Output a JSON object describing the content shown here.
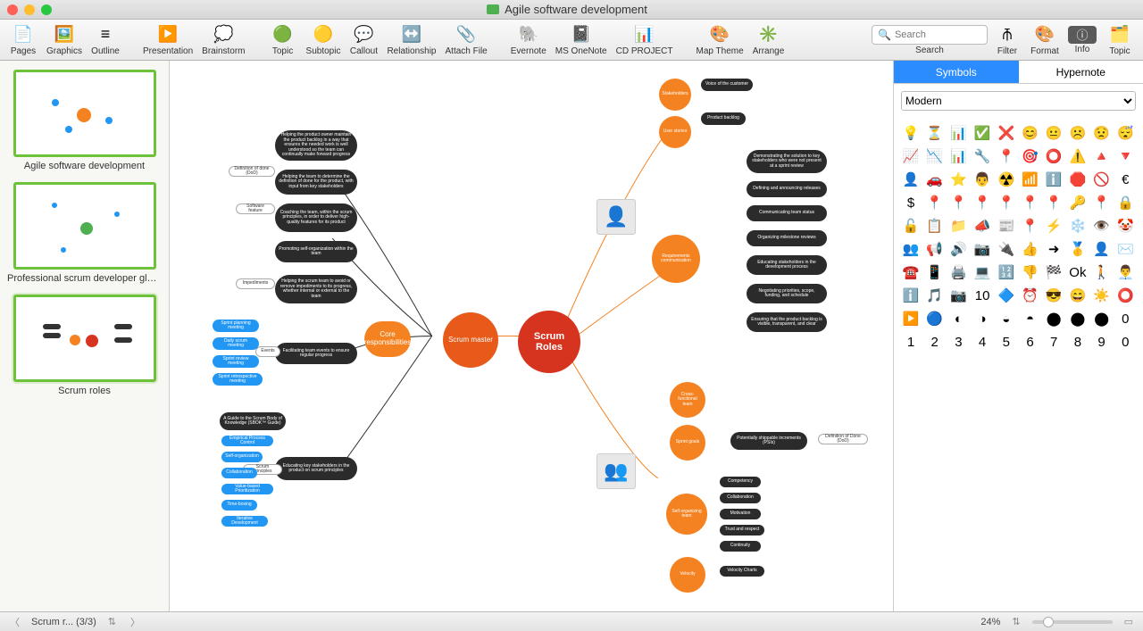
{
  "window": {
    "title": "Agile software development"
  },
  "toolbar": {
    "items": [
      {
        "label": "Pages",
        "icon": "📄"
      },
      {
        "label": "Graphics",
        "icon": "🖼️"
      },
      {
        "label": "Outline",
        "icon": "≡"
      },
      {
        "label": "Presentation",
        "icon": "▶️"
      },
      {
        "label": "Brainstorm",
        "icon": "💭"
      },
      {
        "label": "Topic",
        "icon": "🟢"
      },
      {
        "label": "Subtopic",
        "icon": "🟡"
      },
      {
        "label": "Callout",
        "icon": "💬"
      },
      {
        "label": "Relationship",
        "icon": "↔️"
      },
      {
        "label": "Attach File",
        "icon": "📎"
      },
      {
        "label": "Evernote",
        "icon": "🐘"
      },
      {
        "label": "MS OneNote",
        "icon": "📓"
      },
      {
        "label": "CD PROJECT",
        "icon": "📊"
      },
      {
        "label": "Map Theme",
        "icon": "🎨"
      },
      {
        "label": "Arrange",
        "icon": "✳️"
      }
    ],
    "search_placeholder": "Search",
    "search_label": "Search",
    "filter": "Filter",
    "format": "Format",
    "info": "Info",
    "topic": "Topic"
  },
  "thumbs": [
    {
      "caption": "Agile software development"
    },
    {
      "caption": "Professional scrum developer glos..."
    },
    {
      "caption": "Scrum roles"
    }
  ],
  "map": {
    "center": "Scrum Roles",
    "scrum_master": "Scrum master",
    "core_resp": "Core responsibilities",
    "prod_owner": {
      "stakeholders": "Stakeholders",
      "user_stories": "User stories",
      "voice": "Voice of the customer",
      "backlog": "Product backlog",
      "req_comm": "Requirements communication",
      "comm_items": [
        "Demonstrating the solution to key stakeholders who were not present at a sprint review",
        "Defining and announcing releases",
        "Communicating team status",
        "Organizing milestone reviews",
        "Educating stakeholders in the development process",
        "Negotiating priorities, scope, funding, and schedule",
        "Ensuring that the product backlog is visible, transparent, and clear"
      ]
    },
    "dev_team": {
      "cross": "Cross-functional team",
      "sprint_goals": "Sprint goals",
      "psi": "Potentially shippable increments (PSIs)",
      "dod": "Definition of Done (DoD)",
      "self_org": "Self-organizing team",
      "self_items": [
        "Competency",
        "Collaboration",
        "Motivation",
        "Trust and respect",
        "Continuity"
      ],
      "velocity": "Velocity",
      "velocity_charts": "Velocity Charts"
    },
    "sm_core": {
      "dark_items": [
        "Helping the product owner maintain the product backlog in a way that ensures the needed work is well understood so the team can continually make forward progress",
        "Helping the team to determine the definition of done for the product, with input from key stakeholders",
        "Coaching the team, within the scrum principles, in order to deliver high-quality features for its product",
        "Promoting self-organization within the team",
        "Helping the scrum team to avoid or remove impediments to its progress, whether internal or external to the team",
        "Facilitating team events to ensure regular progress",
        "Educating key stakeholders in the product on scrum principles"
      ],
      "left_tags": [
        "Definition of done (DoD)",
        "Software feature",
        "Impediments",
        "Events",
        "Scrum principles"
      ],
      "blue_items": [
        "Sprint planning meeting",
        "Daily scrum meeting",
        "Sprint review meeting",
        "Sprint retrospective meeting"
      ],
      "guide": "A Guide to the Scrum Body of Knowledge (SBOK™ Guide)",
      "edu_blue": [
        "Empirical Process Control",
        "Self-organization",
        "Collaboration",
        "Value-based Prioritization",
        "Time-boxing",
        "Iterative Development"
      ]
    }
  },
  "rpanel": {
    "tab_symbols": "Symbols",
    "tab_hypernote": "Hypernote",
    "dropdown": "Modern",
    "symbols": [
      "💡",
      "⏳",
      "📊",
      "✅",
      "❌",
      "😊",
      "😐",
      "☹️",
      "😟",
      "😴",
      "📈",
      "📉",
      "📊",
      "🔧",
      "📍",
      "🎯",
      "⭕",
      "⚠️",
      "🔺",
      "🔻",
      "👤",
      "🚗",
      "⭐",
      "👨",
      "☢️",
      "📶",
      "ℹ️",
      "🛑",
      "🚫",
      "€",
      "$",
      "📍",
      "📍",
      "📍",
      "📍",
      "📍",
      "📍",
      "🔑",
      "📍",
      "🔒",
      "🔓",
      "📋",
      "📁",
      "📣",
      "📰",
      "📍",
      "⚡",
      "❄️",
      "👁️",
      "🤡",
      "👥",
      "📢",
      "🔊",
      "📷",
      "🔌",
      "👍",
      "➜",
      "🥇",
      "👤",
      "✉️",
      "☎️",
      "📱",
      "🖨️",
      "💻",
      "🔢",
      "👎",
      "🏁",
      "Ok",
      "🚶",
      "👨‍💼",
      "ℹ️",
      "🎵",
      "📷",
      "10",
      "🔷",
      "⏰",
      "😎",
      "😄",
      "☀️",
      "⭕",
      "▶️",
      "🔵",
      "◐",
      "◑",
      "◒",
      "◓",
      "⬤",
      "⬤",
      "⬤",
      "0",
      "1",
      "2",
      "3",
      "4",
      "5",
      "6",
      "7",
      "8",
      "9",
      "0"
    ]
  },
  "status": {
    "page_name": "Scrum r... (3/3)",
    "zoom": "24%"
  }
}
